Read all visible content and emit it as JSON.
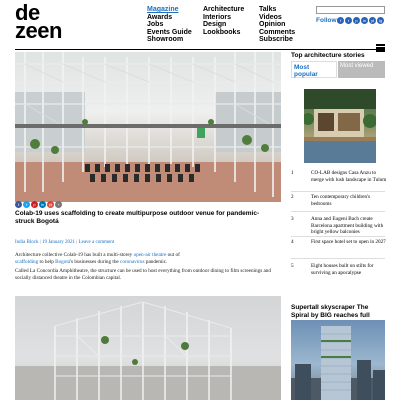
{
  "logo": {
    "line1": "de",
    "line2": "zeen"
  },
  "nav": {
    "col1": [
      "Magazine",
      "Awards",
      "Jobs",
      "Events Guide",
      "Showroom"
    ],
    "col2": [
      "Architecture",
      "Interiors",
      "Design",
      "Lookbooks"
    ],
    "col3": [
      "Talks",
      "Videos",
      "Opinion",
      "Comments",
      "Subscribe"
    ]
  },
  "follow_label": "Follow:",
  "social_icons": [
    "f",
    "t",
    "p",
    "in",
    "yt",
    "ig"
  ],
  "share_icons": [
    "f",
    "t",
    "p",
    "in",
    "@",
    "+"
  ],
  "article": {
    "headline": "Colab-19 uses scaffolding to create multipurpose outdoor venue for pandemic-struck Bogotá",
    "author": "India Block",
    "date": "19 January 2021",
    "comment_link": "Leave a comment",
    "p1_a": "Architecture collective Colab-19 has built a multi-storey ",
    "p1_link1": "open-air theatre",
    "p1_b": " out of ",
    "p1_link2": "scaffolding",
    "p1_c": " to help ",
    "p1_link3": "Bogotá",
    "p1_d": "'s businesses during the ",
    "p1_link4": "coronavirus",
    "p1_e": " pandemic.",
    "p2": "Called La Concordia Amphitheatre, the structure can be used to host everything from outdoor dining to film screenings and socially distanced theatre in the Colombian capital."
  },
  "sidebar": {
    "title": "Top architecture stories",
    "tab_popular": "Most popular",
    "tab_viewed": "Most viewed",
    "items": [
      {
        "num": "1",
        "text": "CO-LAB designs Casa Anzu to merge with lush landscape in Tulum"
      },
      {
        "num": "2",
        "text": "Ten contemporary children's bedrooms"
      },
      {
        "num": "3",
        "text": "Anna and Eugeni Bach create Barcelona apartment building with bright yellow balconies"
      },
      {
        "num": "4",
        "text": "First space hotel set to open in 2027"
      },
      {
        "num": "5",
        "text": "Eight houses built on stilts for surviving an apocalypse"
      }
    ],
    "feature_title": "Supertall skyscraper The Spiral by BIG reaches full height in New York"
  },
  "colors": {
    "link": "#1d6fbf",
    "social": "#2a62b3"
  }
}
